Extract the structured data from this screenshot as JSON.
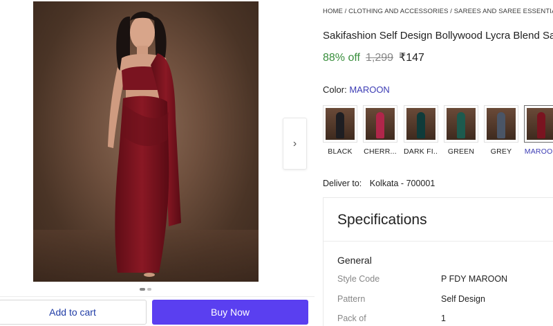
{
  "breadcrumb": "HOME / CLOTHING AND ACCESSORIES / SAREES AND SAREE ESSENTIALS / SAREES",
  "product": {
    "title": "Sakifashion Self Design Bollywood Lycra Blend Saree",
    "discount": "88% off",
    "mrp": "1,299",
    "price": "₹147"
  },
  "gallery": {
    "image_icon": "saree-model-photo",
    "next_icon": "chevron-right-icon",
    "dots_count": 2,
    "active_dot": 0
  },
  "color": {
    "label": "Color:",
    "selected": "MAROON",
    "options": [
      {
        "label": "BLACK",
        "swatch": "#1e1e22"
      },
      {
        "label": "CHERR...",
        "swatch": "#b0264a"
      },
      {
        "label": "DARK FI...",
        "swatch": "#0f3b3a"
      },
      {
        "label": "GREEN",
        "swatch": "#1d5a4e"
      },
      {
        "label": "GREY",
        "swatch": "#4a5566"
      },
      {
        "label": "MAROON",
        "swatch": "#7a1420"
      }
    ]
  },
  "delivery": {
    "label": "Deliver to:",
    "value": "Kolkata - 700001"
  },
  "specifications": {
    "title": "Specifications",
    "group": "General",
    "rows": [
      {
        "key": "Style Code",
        "value": "P FDY MAROON"
      },
      {
        "key": "Pattern",
        "value": "Self Design"
      },
      {
        "key": "Pack of",
        "value": "1"
      }
    ]
  },
  "actions": {
    "add_to_cart": "Add to cart",
    "buy_now": "Buy Now"
  },
  "colors": {
    "accent": "#5a3ff0",
    "discount_green": "#388e3c",
    "link_blue": "#3c3cb4",
    "saree_maroon": "#7a1420"
  }
}
